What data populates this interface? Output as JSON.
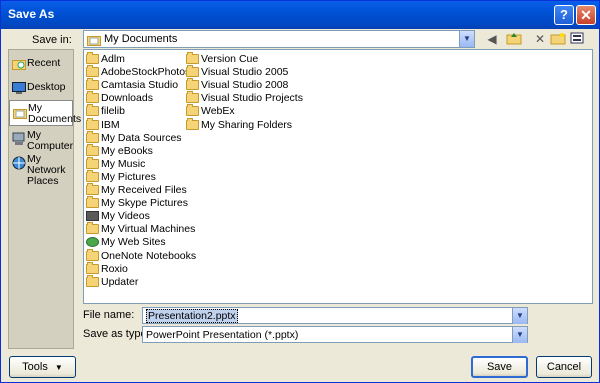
{
  "window": {
    "title": "Save As",
    "help_label": "?",
    "close_label": "✕"
  },
  "save_in": {
    "label": "Save in:",
    "value": "My Documents"
  },
  "places": [
    {
      "label": "Recent"
    },
    {
      "label": "Desktop"
    },
    {
      "label": "My Documents",
      "selected": true
    },
    {
      "label": "My Computer"
    },
    {
      "label": "My Network Places"
    }
  ],
  "files_col1": [
    {
      "name": "Adlm",
      "icon": "folder"
    },
    {
      "name": "AdobeStockPhotos",
      "icon": "folder"
    },
    {
      "name": "Camtasia Studio",
      "icon": "folder"
    },
    {
      "name": "Downloads",
      "icon": "folder"
    },
    {
      "name": "filelib",
      "icon": "folder"
    },
    {
      "name": "IBM",
      "icon": "folder"
    },
    {
      "name": "My Data Sources",
      "icon": "folder"
    },
    {
      "name": "My eBooks",
      "icon": "folder"
    },
    {
      "name": "My Music",
      "icon": "folder"
    },
    {
      "name": "My Pictures",
      "icon": "folder"
    },
    {
      "name": "My Received Files",
      "icon": "folder"
    },
    {
      "name": "My Skype Pictures",
      "icon": "folder"
    },
    {
      "name": "My Videos",
      "icon": "dark"
    },
    {
      "name": "My Virtual Machines",
      "icon": "folder"
    },
    {
      "name": "My Web Sites",
      "icon": "globe"
    },
    {
      "name": "OneNote Notebooks",
      "icon": "folder"
    },
    {
      "name": "Roxio",
      "icon": "folder"
    },
    {
      "name": "Updater",
      "icon": "folder"
    }
  ],
  "files_col2": [
    {
      "name": "Version Cue",
      "icon": "folder"
    },
    {
      "name": "Visual Studio 2005",
      "icon": "folder"
    },
    {
      "name": "Visual Studio 2008",
      "icon": "folder"
    },
    {
      "name": "Visual Studio Projects",
      "icon": "folder"
    },
    {
      "name": "WebEx",
      "icon": "folder"
    },
    {
      "name": "My Sharing Folders",
      "icon": "folder"
    }
  ],
  "file_name": {
    "label": "File name:",
    "value": "Presentation2.pptx"
  },
  "save_as_type": {
    "label": "Save as type:",
    "value": "PowerPoint Presentation (*.pptx)"
  },
  "buttons": {
    "tools": "Tools",
    "save": "Save",
    "cancel": "Cancel"
  },
  "colors": {
    "titlebar": "#0054e3",
    "dialog_bg": "#ece9d8",
    "folder": "#f4d477"
  }
}
